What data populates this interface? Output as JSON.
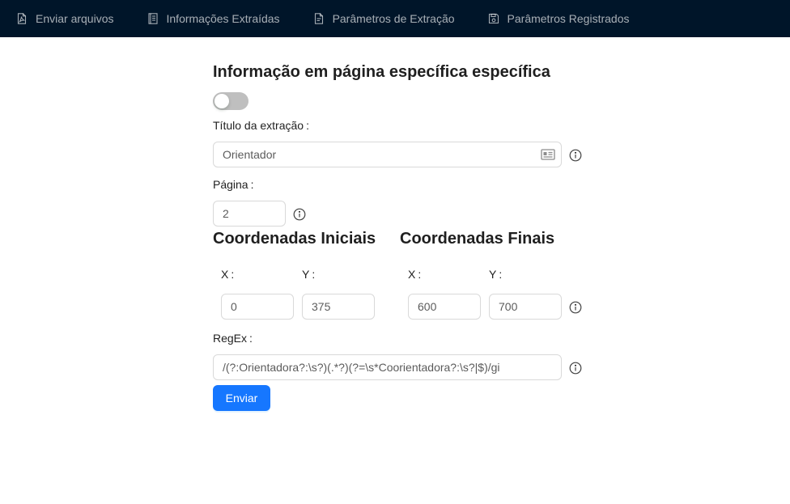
{
  "nav": {
    "items": [
      {
        "label": "Enviar arquivos",
        "icon": "file-pdf-icon"
      },
      {
        "label": "Informações Extraídas",
        "icon": "book-icon"
      },
      {
        "label": "Parâmetros de Extração",
        "icon": "file-text-icon"
      },
      {
        "label": "Parâmetros Registrados",
        "icon": "save-icon"
      }
    ]
  },
  "form": {
    "title": "Informação em página específica específica",
    "toggle_on": false,
    "titulo_label": "Título da extração",
    "titulo_value": "Orientador",
    "pagina_label": "Página",
    "pagina_value": "2",
    "coord_iniciais_title": "Coordenadas Iniciais",
    "coord_finais_title": "Coordenadas Finais",
    "x_label": "X",
    "y_label": "Y",
    "x_inicial": "0",
    "y_inicial": "375",
    "x_final": "600",
    "y_final": "700",
    "regex_label": "RegEx",
    "regex_value": "/(?:Orientadora?:\\s?)(.*?)(?=\\s*Coorientadora?:\\s?|$)/gi",
    "submit_label": "Enviar"
  },
  "colors": {
    "navbar_bg": "#001529",
    "primary": "#1677ff",
    "toggle_off": "#bfbfbf"
  }
}
